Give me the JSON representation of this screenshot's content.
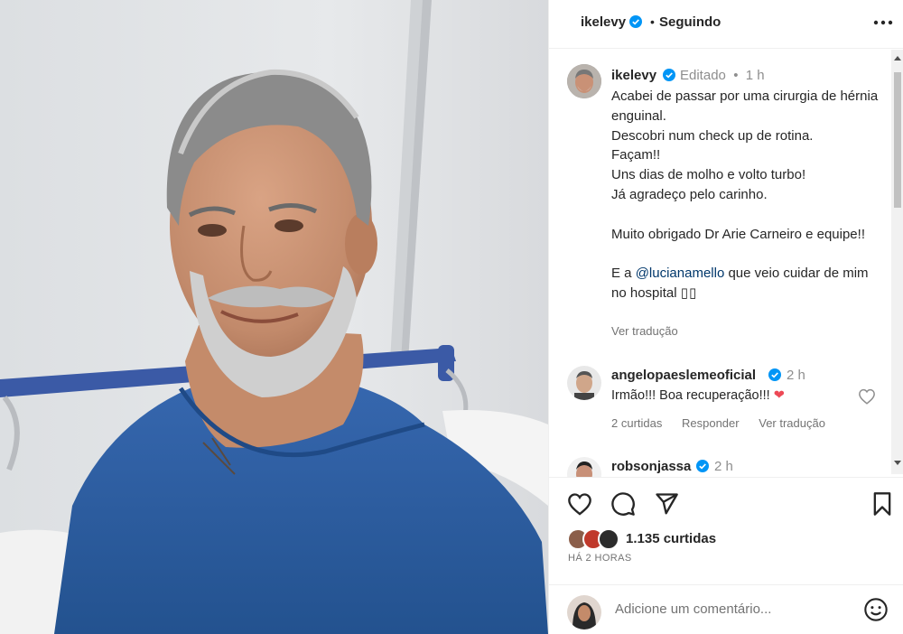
{
  "header": {
    "username": "ikelevy",
    "separator": "•",
    "follow_status": "Seguindo"
  },
  "caption": {
    "username": "ikelevy",
    "meta": "Editado  •  1 h",
    "line1": "Acabei de passar por uma cirurgia de hérnia enguinal.\nDescobri num check up de rotina.\nFaçam!!\nUns dias de molho e volto turbo!\nJá agradeço pelo carinho.\n\nMuito obrigado Dr Arie Carneiro e equipe!!\n\nE a ",
    "mention": "@lucianamello",
    "line2": " que veio cuidar de mim no hospital ",
    "emoji": "▯▯",
    "translate": "Ver tradução"
  },
  "comments": [
    {
      "username": "angelopaeslemeoficial",
      "time": "2 h",
      "text": "Irmão!!! Boa recuperação!!!",
      "emoji": "❤",
      "likes": "2 curtidas",
      "reply": "Responder",
      "translate": "Ver tradução"
    },
    {
      "username": "robsonjassa",
      "time": "2 h"
    }
  ],
  "stats": {
    "likes": "1.135 curtidas",
    "ago": "HÁ 2 HORAS"
  },
  "comment_box": {
    "placeholder": "Adicione um comentário..."
  },
  "colors": {
    "verified": "#0095f6",
    "heart_red": "#ed4956",
    "gown": "#2a5fa8"
  },
  "icons": [
    "verified-badge-icon",
    "more-options-icon",
    "like-icon",
    "comment-icon",
    "share-icon",
    "save-icon",
    "emoji-icon",
    "comment-like-icon"
  ]
}
